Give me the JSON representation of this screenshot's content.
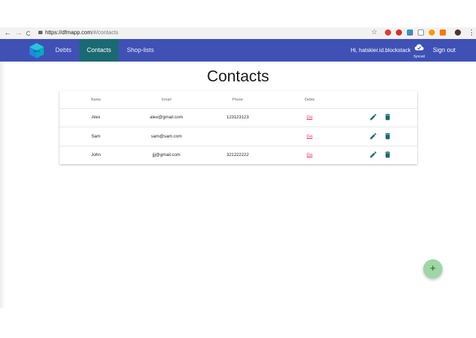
{
  "browser": {
    "back": "←",
    "forward": "→",
    "reload": "C",
    "url_host": "https://dfmapp.com",
    "url_path": "/#/contacts",
    "star": "☆",
    "menu": "⋮"
  },
  "app": {
    "nav": [
      {
        "label": "Debts"
      },
      {
        "label": "Contacts"
      },
      {
        "label": "Shop-lists"
      }
    ],
    "active_nav": "Contacts",
    "user_greeting": "Hi, hatskier.id.blockstack",
    "sync_label": "Synced",
    "signout_label": "Sign out",
    "colors": {
      "navbar": "#3f51b5",
      "active_tab": "#1b6a73",
      "link": "#e91e63",
      "icon": "#1b6a73",
      "fab": "#9fd6a5"
    }
  },
  "page": {
    "title": "Contacts"
  },
  "table": {
    "headers": [
      "Name",
      "Email",
      "Phone",
      "Debts"
    ],
    "rows": [
      {
        "name": "Alex",
        "email": "alex@gmail.com",
        "phone": "123123123",
        "debts": "Go"
      },
      {
        "name": "Sam",
        "email": "sam@sam.com",
        "phone": "",
        "debts": "Go"
      },
      {
        "name": "John",
        "email": "jjj@gmail.com",
        "phone": "321222222",
        "debts": "Go"
      }
    ]
  },
  "fab": {
    "label": "+"
  },
  "icons": {
    "edit": "pencil-icon",
    "delete": "trash-icon",
    "sync": "cloud-check-icon"
  }
}
